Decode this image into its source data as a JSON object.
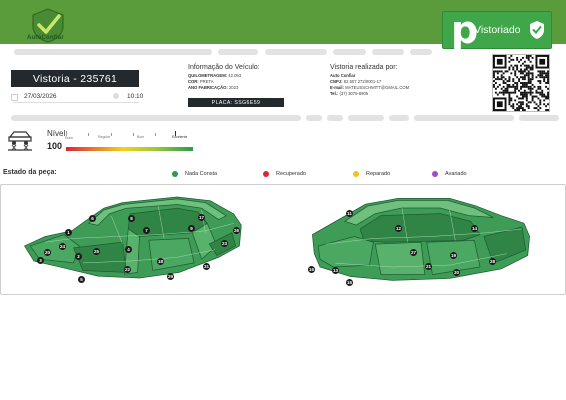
{
  "header": {
    "logo_text": "AutoConfiar",
    "badge_label": "Vistoriado",
    "badge_letter": "p"
  },
  "inspection": {
    "title": "Vistoria - 235761",
    "date": "27/03/2026",
    "time": "10:10"
  },
  "vehicle": {
    "heading": "Informação do Veículo:",
    "lines": [
      {
        "label": "QUILOMETRAGEM:",
        "value": "42.093"
      },
      {
        "label": "COR:",
        "value": "PRETA"
      },
      {
        "label": "ANO FABRICAÇÃO:",
        "value": "2023"
      }
    ],
    "plate": "PLACA: SSG6E59"
  },
  "inspector": {
    "heading": "Vistoria realizada por:",
    "lines": [
      {
        "label": "",
        "value": "Auto Confiar"
      },
      {
        "label": "CNPJ:",
        "value": "82.507.272/0001-17"
      },
      {
        "label": "E-mail:",
        "value": "MATEUSSCHMITT@GMAIL.COM"
      },
      {
        "label": "Tel.:",
        "value": "(37) 3075-8905"
      }
    ]
  },
  "level": {
    "title": "Nível",
    "value": "100",
    "ticks": [
      "Ruim",
      "Regular",
      "Bom",
      "Excelente"
    ]
  },
  "state": {
    "title": "Estado da peça:",
    "legend": [
      {
        "label": "Nada Consta",
        "color": "#2e9b48"
      },
      {
        "label": "Recuperado",
        "color": "#d9263a"
      },
      {
        "label": "Reparado",
        "color": "#f2c21b"
      },
      {
        "label": "Avariado",
        "color": "#a04ad0"
      }
    ]
  },
  "parts_left": [
    "1",
    "2",
    "3",
    "4",
    "5",
    "6",
    "7",
    "8",
    "9",
    "17",
    "18",
    "20",
    "22",
    "23",
    "24",
    "25",
    "26",
    "29",
    "31"
  ],
  "parts_right": [
    "11",
    "12",
    "13",
    "14",
    "15",
    "16",
    "19",
    "21",
    "27",
    "28",
    "30"
  ],
  "colors": {
    "accent_green": "#5a9b3c",
    "body_green": "#3e9c57",
    "dark": "#24292e"
  }
}
